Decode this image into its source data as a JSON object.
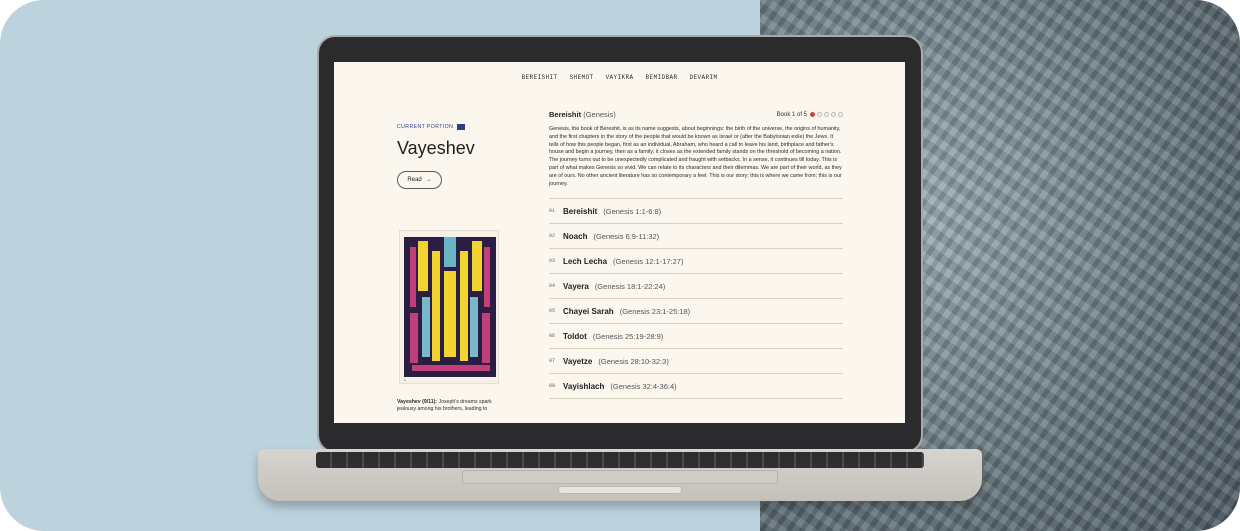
{
  "nav": [
    "BEREISHIT",
    "SHEMOT",
    "VAYIKRA",
    "BEMIDBAR",
    "DEVARIM"
  ],
  "current_portion": {
    "label": "CURRENT PORTION",
    "title": "Vayeshev",
    "read_button": "Read",
    "description_bold": "Vayeshev (9/11):",
    "description": "Joseph's dreams spark jealousy among his brothers, leading to"
  },
  "book": {
    "name": "Bereishit",
    "english": "(Genesis)",
    "count_label": "Book 1 of 5",
    "dots_active": 1,
    "dots_total": 5,
    "description": "Genesis, the book of Bereshit, is as its name suggests, about beginnings: the birth of the universe, the origins of humanity, and the first chapters in the story of the people that would be known as Israel or (after the Babylonian exile) the Jews. It tells of how this people began, first as an individual, Abraham, who heard a call to leave his land, birthplace and father's house and begin a journey, then as a family; it closes as the extended family stands on the threshold of becoming a nation. The journey turns out to be unexpectedly complicated and fraught with setbacks. In a sense, it continues till today. This is part of what makes Genesis so vivid. We can relate to its characters and their dilemmas. We are part of their world, as they are of ours. No other ancient literature has so contemporary a feel. This is our story; this is where we came from; this is our journey."
  },
  "portions": [
    {
      "num": "01",
      "name": "Bereishit",
      "ref": "(Genesis 1:1-6:8)"
    },
    {
      "num": "02",
      "name": "Noach",
      "ref": "(Genesis 6:9-11:32)"
    },
    {
      "num": "03",
      "name": "Lech Lecha",
      "ref": "(Genesis 12:1-17:27)"
    },
    {
      "num": "04",
      "name": "Vayera",
      "ref": "(Genesis 18:1-22:24)"
    },
    {
      "num": "05",
      "name": "Chayei Sarah",
      "ref": "(Genesis 23:1-25:18)"
    },
    {
      "num": "06",
      "name": "Toldot",
      "ref": "(Genesis 25:19-28:9)"
    },
    {
      "num": "07",
      "name": "Vayetze",
      "ref": "(Genesis 28:10-32:3)"
    },
    {
      "num": "08",
      "name": "Vayishlach",
      "ref": "(Genesis 32:4-36:4)"
    }
  ],
  "colors": {
    "accent": "#2a3f86",
    "dot_active": "#c6473b",
    "screen_bg": "#fbf7ee",
    "backdrop": "#bcd3de"
  }
}
